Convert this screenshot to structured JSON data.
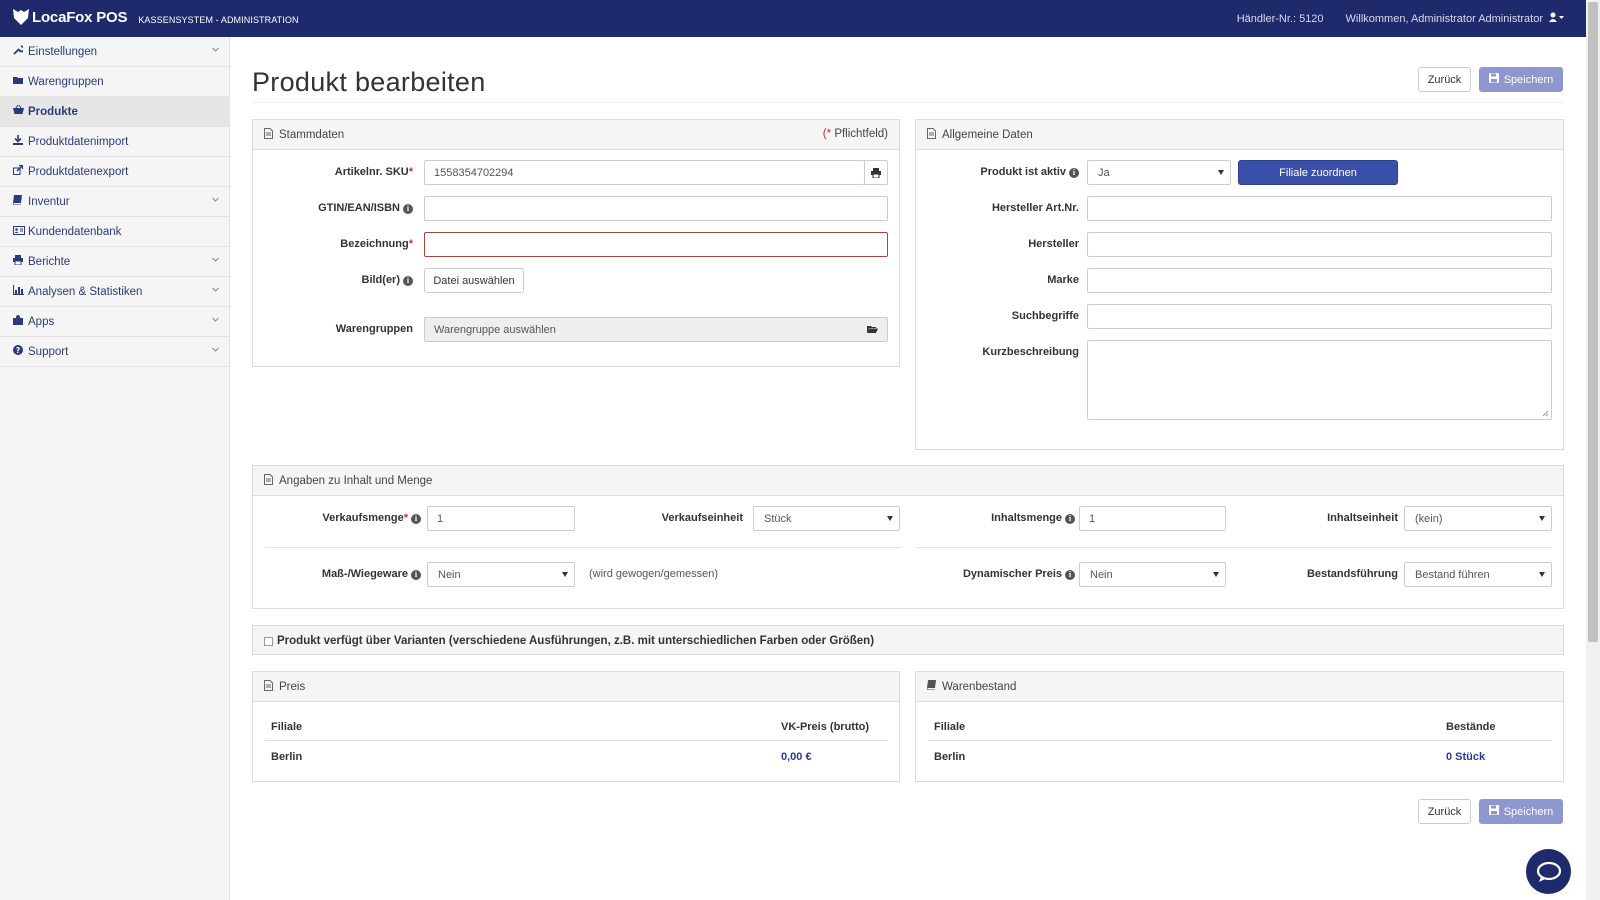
{
  "topbar": {
    "brand": "LocaFox POS",
    "subtitle": "KASSENSYSTEM - ADMINISTRATION",
    "merchant": "Händler-Nr.: 5120",
    "welcome": "Willkommen, Administrator Administrator"
  },
  "sidebar": {
    "items": [
      {
        "label": "Einstellungen",
        "icon": "wrench-icon",
        "expandable": true
      },
      {
        "label": "Warengruppen",
        "icon": "folder-open-icon",
        "expandable": false
      },
      {
        "label": "Produkte",
        "icon": "basket-icon",
        "expandable": false,
        "active": true
      },
      {
        "label": "Produktdatenimport",
        "icon": "download-icon",
        "expandable": false
      },
      {
        "label": "Produktdatenexport",
        "icon": "share-icon",
        "expandable": false
      },
      {
        "label": "Inventur",
        "icon": "book-icon",
        "expandable": true
      },
      {
        "label": "Kundendatenbank",
        "icon": "id-card-icon",
        "expandable": false
      },
      {
        "label": "Berichte",
        "icon": "print-icon",
        "expandable": true
      },
      {
        "label": "Analysen & Statistiken",
        "icon": "bar-chart-icon",
        "expandable": true
      },
      {
        "label": "Apps",
        "icon": "puzzle-icon",
        "expandable": true
      },
      {
        "label": "Support",
        "icon": "question-icon",
        "expandable": true
      }
    ]
  },
  "page": {
    "title": "Produkt bearbeiten",
    "back_label": "Zurück",
    "save_label": "Speichern"
  },
  "stammdaten": {
    "title": "Stammdaten",
    "required_note": "Pflichtfeld)",
    "required_star": "(*",
    "sku_label": "Artikelnr. SKU",
    "sku_value": "1558354702294",
    "gtin_label": "GTIN/EAN/ISBN",
    "gtin_value": "",
    "name_label": "Bezeichnung",
    "name_value": "",
    "images_label": "Bild(er)",
    "file_button": "Datei auswählen",
    "groups_label": "Warengruppen",
    "groups_value": "Warengruppe auswählen"
  },
  "allgemein": {
    "title": "Allgemeine Daten",
    "active_label": "Produkt ist aktiv",
    "active_value": "Ja",
    "assign_button": "Filiale zuordnen",
    "manuf_art_label": "Hersteller Art.Nr.",
    "manuf_label": "Hersteller",
    "brand_label": "Marke",
    "search_label": "Suchbegriffe",
    "desc_label": "Kurzbeschreibung"
  },
  "menge": {
    "title": "Angaben zu Inhalt und Menge",
    "sell_qty_label": "Verkaufsmenge",
    "sell_qty_value": "1",
    "sell_unit_label": "Verkaufseinheit",
    "sell_unit_value": "Stück",
    "content_qty_label": "Inhaltsmenge",
    "content_qty_value": "1",
    "content_unit_label": "Inhaltseinheit",
    "content_unit_value": "(kein)",
    "weigh_label": "Maß-/Wiegeware",
    "weigh_value": "Nein",
    "weigh_hint": "(wird gewogen/gemessen)",
    "dyn_label": "Dynamischer Preis",
    "dyn_value": "Nein",
    "stock_label": "Bestandsführung",
    "stock_value": "Bestand führen"
  },
  "variants": {
    "label": "Produkt verfügt über Varianten (verschiedene Ausführungen, z.B. mit unterschiedlichen Farben oder Größen)"
  },
  "preis": {
    "title": "Preis",
    "col_branch": "Filiale",
    "col_price": "VK-Preis (brutto)",
    "rows": [
      {
        "branch": "Berlin",
        "price": "0,00 €"
      }
    ]
  },
  "bestand": {
    "title": "Warenbestand",
    "col_branch": "Filiale",
    "col_stock": "Bestände",
    "rows": [
      {
        "branch": "Berlin",
        "stock": "0 Stück"
      }
    ]
  },
  "colors": {
    "topbar": "#1e2a6b",
    "primary": "#3a4fa8",
    "primary_light": "#8e97cf",
    "error": "#c9302c",
    "link": "#2b3a9a"
  }
}
